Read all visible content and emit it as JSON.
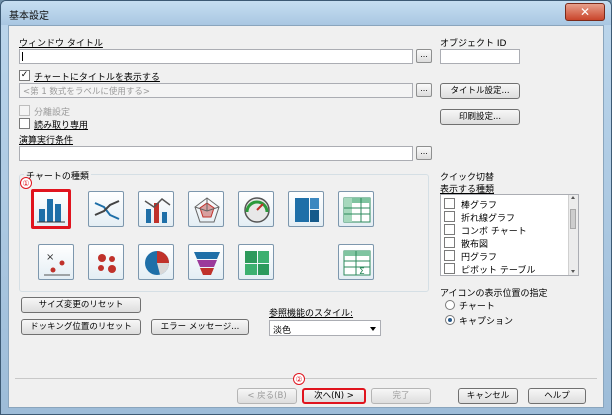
{
  "window": {
    "title": "基本設定",
    "close_glyph": "✕"
  },
  "general": {
    "window_title_label": "ウィンドウ タイトル",
    "object_id_label": "オブジェクト ID",
    "show_title_label": "チャートにタイトルを表示する",
    "title_placeholder": "<第 1 数式をラベルに使用する>",
    "title_settings_button": "タイトル設定...",
    "detach_label": "分離設定",
    "readonly_label": "読み取り専用",
    "print_settings_button": "印刷設定...",
    "calc_condition_label": "演算実行条件",
    "ellipsis": "..."
  },
  "chart_types": {
    "group_label": "チャートの種類",
    "marker_1": "①",
    "items": [
      "bar-chart-icon",
      "line-chart-icon",
      "combo-chart-icon",
      "radar-chart-icon",
      "gauge-chart-icon",
      "block-chart-icon",
      "pivot-table-icon",
      "scatter-chart-icon",
      "grid-chart-icon",
      "pie-chart-icon",
      "funnel-chart-icon",
      "mekko-chart-icon",
      "straight-table-icon"
    ]
  },
  "quick_change": {
    "group_label": "クイック切替",
    "types_label": "表示する種類",
    "items": [
      "棒グラフ",
      "折れ線グラフ",
      "コンボ チャート",
      "散布図",
      "円グラフ",
      "ピボット テーブル"
    ]
  },
  "icon_position": {
    "label": "アイコンの表示位置の指定",
    "options": [
      "チャート",
      "キャプション"
    ],
    "selected": "キャプション"
  },
  "actions": {
    "reset_size_button": "サイズ変更のリセット",
    "reset_docking_button": "ドッキング位置のリセット",
    "error_message_button": "エラー メッセージ...",
    "reference_style_label": "参照機能のスタイル:",
    "reference_style_value": "淡色"
  },
  "footer": {
    "marker_2": "②",
    "back_button": "< 戻る(B)",
    "next_button": "次へ(N) >",
    "finish_button": "完了",
    "cancel_button": "キャンセル",
    "help_button": "ヘルプ"
  },
  "colors": {
    "highlight": "#e0141e",
    "titlebar": "#b8d3ea",
    "dialog_bg": "#f0f0f0"
  }
}
